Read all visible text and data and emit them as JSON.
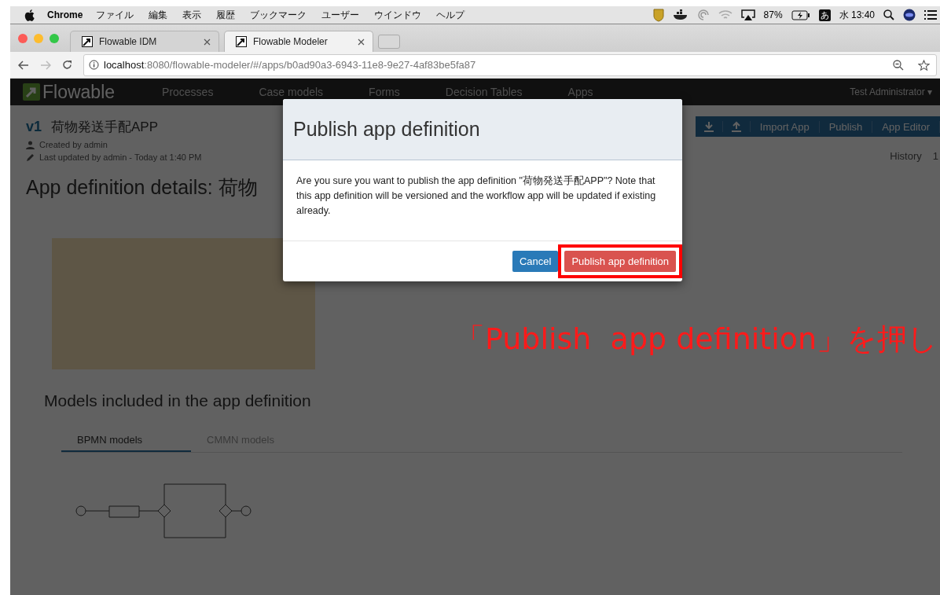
{
  "menubar": {
    "app": "Chrome",
    "menus": [
      "ファイル",
      "編集",
      "表示",
      "履歴",
      "ブックマーク",
      "ユーザー",
      "ウインドウ",
      "ヘルプ"
    ],
    "battery": "87%",
    "input_mode": "あ",
    "clock": "水 13:40"
  },
  "browser": {
    "tabs": [
      {
        "title": "Flowable IDM",
        "selected": false
      },
      {
        "title": "Flowable Modeler",
        "selected": true
      }
    ],
    "url_host": "localhost",
    "url_rest": ":8080/flowable-modeler/#/apps/b0ad90a3-6943-11e8-9e27-4af83be5fa87"
  },
  "page": {
    "brand": "Flowable",
    "nav": [
      "Processes",
      "Case models",
      "Forms",
      "Decision Tables",
      "Apps"
    ],
    "user": "Test Administrator ▾",
    "toolbar": [
      "Import App",
      "Publish",
      "App Editor"
    ],
    "version": "v1",
    "app_name": "荷物発送手配APP",
    "created": "Created by admin",
    "updated": "Last updated by admin - Today at 1:40 PM",
    "details_title": "App definition details: 荷物",
    "history": "History",
    "history_count": "1",
    "models_heading": "Models included in the app definition",
    "model_tabs": [
      {
        "label": "BPMN models",
        "selected": true
      },
      {
        "label": "CMMN models",
        "selected": false
      }
    ]
  },
  "dialog": {
    "title": "Publish app definition",
    "message": "Are you sure you want to publish the app definition \"荷物発送手配APP\"? Note that this app definition will be versioned and the workflow app will be updated if existing already.",
    "buttons": [
      {
        "label": "Cancel",
        "kind": "cancel",
        "highlighted": false
      },
      {
        "label": "Publish app definition",
        "kind": "primary",
        "highlighted": true
      }
    ]
  },
  "annotation": {
    "text": "「Publish  app definition」を押し"
  }
}
